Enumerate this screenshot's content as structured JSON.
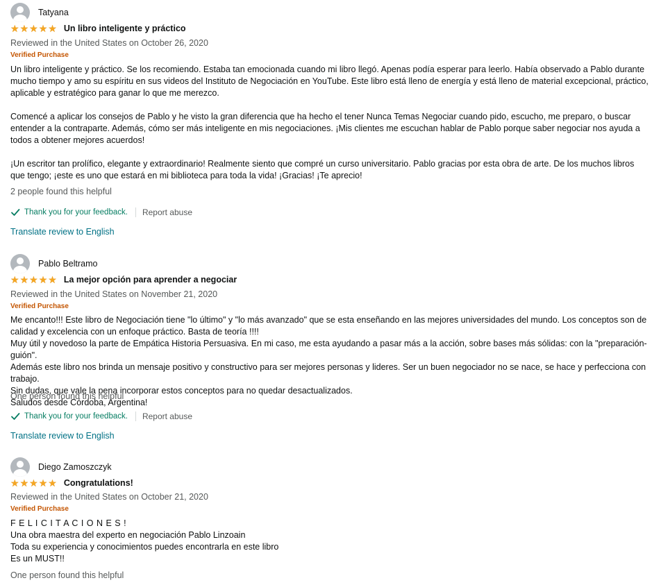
{
  "reviews": [
    {
      "name": "Tatyana",
      "title": "Un libro inteligente y práctico",
      "rating": 5,
      "date": "Reviewed in the United States on October 26, 2020",
      "verified": "Verified Purchase",
      "paragraphs": [
        "Un libro inteligente y práctico. Se los recomiendo. Estaba tan emocionada cuando mi libro llegó. Apenas podía esperar para leerlo. Había observado a Pablo durante mucho tiempo y amo su espíritu en sus videos del Instituto de Negociación en YouTube. Este libro está lleno de energía y está lleno de material excepcional, práctico, aplicable y estratégico para ganar lo que me merezco.",
        "Comencé a aplicar los consejos de Pablo y he visto la gran diferencia que ha hecho el tener Nunca Temas Negociar cuando pido, escucho, me preparo, o buscar entender a la contraparte. Además, cómo ser más inteligente en mis negociaciones. ¡Mis clientes me escuchan hablar de Pablo porque saber negociar nos ayuda a todos a obtener mejores acuerdos!",
        "¡Un escritor tan prolífico, elegante y extraordinario! Realmente siento que compré un curso universitario. Pablo gracias por esta obra de arte. De los muchos libros que tengo; ¡este es uno que estará en mi biblioteca para toda la vida! ¡Gracias! ¡Te aprecio!"
      ],
      "helpful": "2 people found this helpful",
      "thanks": "Thank you for your feedback.",
      "report": "Report abuse",
      "translate": "Translate review to English"
    },
    {
      "name": "Pablo Beltramo",
      "title": "La mejor opción para aprender a negociar",
      "rating": 5,
      "date": "Reviewed in the United States on November 21, 2020",
      "verified": "Verified Purchase",
      "lines": [
        "Me encanto!!! Este libro de Negociación tiene \"lo último\" y \"lo más avanzado\" que se esta enseñando en las mejores universidades del mundo. Los conceptos son de calidad y excelencia con un enfoque práctico. Basta de teoría !!!!",
        "Muy útil y novedoso la parte de Empática Historia Persuasiva. En mi caso, me esta ayudando a pasar más a la acción, sobre bases más sólidas: con la \"preparación-guión\".",
        "Además este libro nos brinda un mensaje positivo y constructivo para ser mejores personas y lideres. Ser un buen negociador no se nace, se hace y perfecciona con trabajo.",
        "Sin dudas, que vale la pena incorporar estos conceptos para no quedar desactualizados.",
        "Saludos desde Córdoba, Argentina!"
      ],
      "helpful": "One person found this helpful",
      "thanks": "Thank you for your feedback.",
      "report": "Report abuse",
      "translate": "Translate review to English"
    },
    {
      "name": "Diego Zamoszczyk",
      "title": "Congratulations!",
      "rating": 5,
      "date": "Reviewed in the United States on October 21, 2020",
      "verified": "Verified Purchase",
      "lines": [
        "F E L I C I T A C I O N E S !",
        "Una obra maestra del experto en negociación Pablo Linzoain",
        "Toda su experiencia y conocimientos puedes encontrarla en este libro",
        "Es un MUST!!"
      ],
      "helpful": "One person found this helpful"
    }
  ],
  "colors": {
    "star": "#f5a623",
    "verified": "#c45500",
    "link": "#007185",
    "thanks": "#067d62",
    "muted": "#565959"
  }
}
